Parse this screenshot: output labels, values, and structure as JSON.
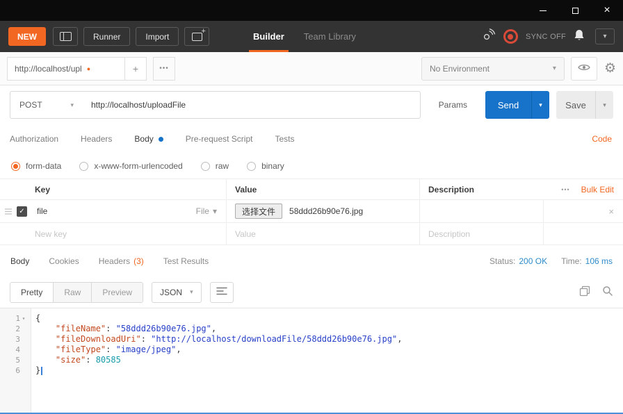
{
  "icons": {
    "close": "×",
    "chevron_down": "▾",
    "dot": "●",
    "plus": "+",
    "ellipsis": "•••",
    "check": "✓",
    "gear": "⚙",
    "fold": "▾"
  },
  "colors": {
    "accent_orange": "#f26722",
    "send_blue": "#1673c9",
    "sync_red": "#d94a38",
    "status_value_blue": "#2e8bc9",
    "json_key": "#c2481f",
    "json_string": "#2840c8",
    "json_number": "#169bab"
  },
  "header": {
    "new_label": "NEW",
    "runner_label": "Runner",
    "import_label": "Import",
    "builder_label": "Builder",
    "team_library_label": "Team Library",
    "sync_label": "SYNC OFF"
  },
  "tabstrip": {
    "tab_title": "http://localhost/upl",
    "environment_value": "No Environment"
  },
  "request": {
    "method": "POST",
    "url": "http://localhost/uploadFile",
    "params_label": "Params",
    "send_label": "Send",
    "save_label": "Save",
    "code_label": "Code",
    "tabs": [
      {
        "label": "Authorization"
      },
      {
        "label": "Headers"
      },
      {
        "label": "Body"
      },
      {
        "label": "Pre-request Script"
      },
      {
        "label": "Tests"
      }
    ],
    "body_types": [
      {
        "label": "form-data",
        "selected": true
      },
      {
        "label": "x-www-form-urlencoded",
        "selected": false
      },
      {
        "label": "raw",
        "selected": false
      },
      {
        "label": "binary",
        "selected": false
      }
    ]
  },
  "formdata": {
    "col_key": "Key",
    "col_value": "Value",
    "col_description": "Description",
    "bulk_edit_label": "Bulk Edit",
    "row": {
      "key": "file",
      "type_label": "File",
      "choose_file_label": "选择文件",
      "file_name": "58ddd26b90e76.jpg"
    },
    "new_row": {
      "key_placeholder": "New key",
      "value_placeholder": "Value",
      "description_placeholder": "Description"
    }
  },
  "response": {
    "tab_body": "Body",
    "tab_cookies": "Cookies",
    "tab_headers": "Headers",
    "tab_headers_count": "(3)",
    "tab_tests": "Test Results",
    "status_label": "Status:",
    "status_value": "200 OK",
    "time_label": "Time:",
    "time_value": "106 ms",
    "view_pretty": "Pretty",
    "view_raw": "Raw",
    "view_preview": "Preview",
    "format_value": "JSON"
  },
  "code": {
    "lines": [
      {
        "n": "1",
        "punct": "{"
      },
      {
        "n": "2",
        "key": "    \"fileName\"",
        "sep": ": ",
        "str": "\"58ddd26b90e76.jpg\"",
        "end": ","
      },
      {
        "n": "3",
        "key": "    \"fileDownloadUri\"",
        "sep": ": ",
        "str": "\"http://localhost/downloadFile/58ddd26b90e76.jpg\"",
        "end": ","
      },
      {
        "n": "4",
        "key": "    \"fileType\"",
        "sep": ": ",
        "str": "\"image/jpeg\"",
        "end": ","
      },
      {
        "n": "5",
        "key": "    \"size\"",
        "sep": ": ",
        "num": "80585"
      },
      {
        "n": "6",
        "punct": "}"
      }
    ]
  }
}
